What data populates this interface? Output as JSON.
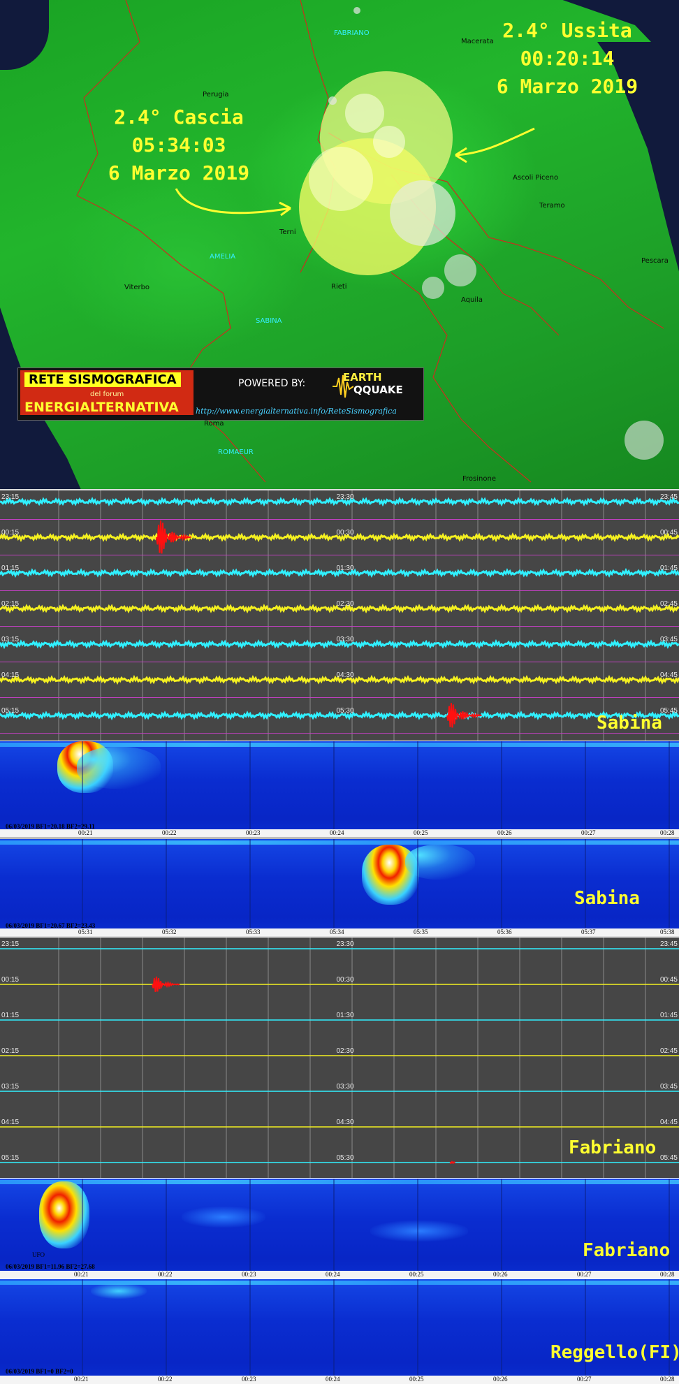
{
  "map": {
    "cities_dark": [
      "Perugia",
      "Macerata",
      "Terni",
      "Rieti",
      "Viterbo",
      "Ascoli Piceno",
      "Teramo",
      "Aquila",
      "Pescara",
      "Roma",
      "Frosinone"
    ],
    "cities_cyan": [
      "FABRIANO",
      "AMELIA",
      "SABINA",
      "ROMAEUR"
    ],
    "event_ussita": {
      "magnitude": "2.4° Ussita",
      "time": "00:20:14",
      "date": "6 Marzo 2019"
    },
    "event_cascia": {
      "magnitude": "2.4° Cascia",
      "time": "05:34:03",
      "date": "6 Marzo 2019"
    },
    "banner": {
      "title": "RETE SISMOGRAFICA",
      "forum": "del forum",
      "name": "ENERGIALTERNATIVA",
      "powered": "POWERED BY:",
      "logo_top": "EARTH",
      "logo_bottom": "QQUAKE",
      "url": "http://www.energialternativa.info/ReteSismografica"
    }
  },
  "helicorder_sabina": {
    "station": "Sabina",
    "left_labels": [
      "23:15",
      "00:15",
      "01:15",
      "02:15",
      "03:15",
      "04:15",
      "05:15"
    ],
    "mid_labels": [
      "23:30",
      "00:30",
      "01:30",
      "02:30",
      "03:30",
      "04:30",
      "05:30"
    ],
    "right_labels": [
      "23:45",
      "00:45",
      "01:45",
      "02:45",
      "03:45",
      "04:45",
      "05:45"
    ]
  },
  "spectrogram_1": {
    "info": "06/03/2019 BF1=20.18 BF2=29.11",
    "ticks": [
      "00:21",
      "00:22",
      "00:23",
      "00:24",
      "00:25",
      "00:26",
      "00:27",
      "00:28"
    ]
  },
  "spectrogram_2": {
    "station": "Sabina",
    "info": "06/03/2019 BF1=20.67 BF2=23.43",
    "ticks": [
      "05:31",
      "05:32",
      "05:33",
      "05:34",
      "05:35",
      "05:36",
      "05:37",
      "05:38"
    ]
  },
  "helicorder_fabriano": {
    "station": "Fabriano",
    "left_labels": [
      "23:15",
      "00:15",
      "01:15",
      "02:15",
      "03:15",
      "04:15",
      "05:15"
    ],
    "mid_labels": [
      "23:30",
      "00:30",
      "01:30",
      "02:30",
      "03:30",
      "04:30",
      "05:30"
    ],
    "right_labels": [
      "23:45",
      "00:45",
      "01:45",
      "02:45",
      "03:45",
      "04:45",
      "05:45"
    ]
  },
  "spectrogram_3": {
    "station": "Fabriano",
    "ufo": "UFO",
    "info": "06/03/2019 BF1=11.96 BF2=27.68",
    "ticks": [
      "00:21",
      "00:22",
      "00:23",
      "00:24",
      "00:25",
      "00:26",
      "00:27",
      "00:28"
    ]
  },
  "spectrogram_4": {
    "station": "Reggello(FI)",
    "info": "06/03/2019 BF1=0 BF2=0",
    "ticks": [
      "00:21",
      "00:22",
      "00:23",
      "00:24",
      "00:25",
      "00:26",
      "00:27",
      "00:28"
    ]
  },
  "colors": {
    "label_yellow": "#ffff30",
    "trace_cyan": "#30f0ff",
    "trace_yellow": "#f4f020",
    "event_red": "#ff1010"
  }
}
